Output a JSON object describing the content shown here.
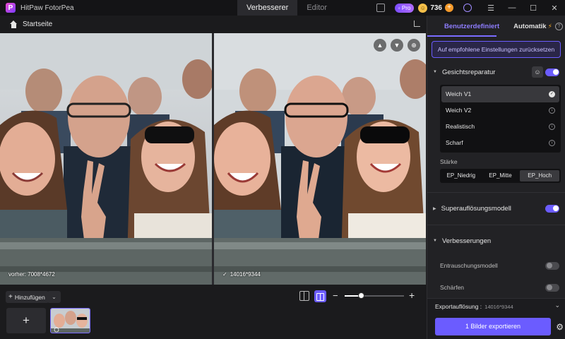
{
  "app": {
    "title": "HitPaw FotorPea",
    "logo_letter": "P"
  },
  "mode_tabs": [
    {
      "label": "Verbesserer",
      "active": true
    },
    {
      "label": "Editor",
      "active": false
    }
  ],
  "topbar": {
    "pro_label": "Pro",
    "pro_prefix": "◦",
    "credits": "736"
  },
  "breadcrumb": {
    "home_label": "Startseite"
  },
  "compare": {
    "before_caption": "vorher: 7008*4672",
    "after_caption": "14016*9344"
  },
  "bottom": {
    "add_label": "Hinzufügen",
    "zoom_level": 0.27
  },
  "sidebar": {
    "tabs": [
      {
        "label": "Benutzerdefiniert",
        "active": true
      },
      {
        "label": "Automatik",
        "active": false
      }
    ],
    "reset_label": "Auf empfohlene Einstellungen zurücksetzen",
    "face_repair": {
      "title": "Gesichtsreparatur",
      "enabled": true,
      "models": [
        {
          "label": "Weich V1",
          "status": "selected"
        },
        {
          "label": "Weich V2",
          "status": "download"
        },
        {
          "label": "Realistisch",
          "status": "download"
        },
        {
          "label": "Scharf",
          "status": "download"
        }
      ],
      "strength_label": "Stärke",
      "strength_options": [
        "EP_Niedrig",
        "EP_Mitte",
        "EP_Hoch"
      ],
      "strength_selected": "EP_Hoch"
    },
    "superres": {
      "title": "Superauflösungsmodell",
      "enabled": true
    },
    "improvements": {
      "title": "Verbesserungen",
      "items": [
        {
          "label": "Entrauschungsmodell",
          "enabled": false
        },
        {
          "label": "Schärfen",
          "enabled": false
        }
      ]
    },
    "export": {
      "resolution_label": "Exportauflösung :",
      "resolution_value": "14016*9344",
      "button_label": "1 Bilder exportieren"
    }
  },
  "colors": {
    "accent": "#6b5cff",
    "panel": "#222225",
    "background": "#1b1b1d"
  }
}
